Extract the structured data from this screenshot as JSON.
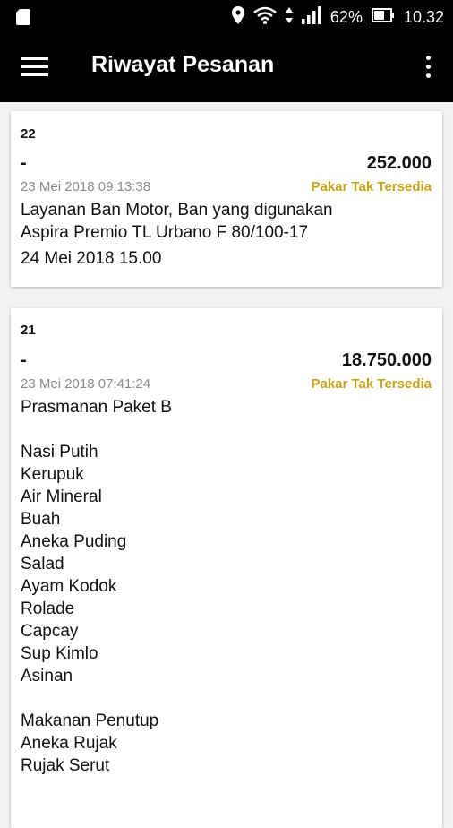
{
  "status_bar": {
    "battery_percent": "62%",
    "time": "10.32"
  },
  "app_bar": {
    "title": "Riwayat Pesanan"
  },
  "orders": [
    {
      "number": "22",
      "dash": "-",
      "price": "252.000",
      "datetime": "23 Mei 2018 09:13:38",
      "status": "Pakar Tak Tersedia",
      "lines": [
        "Layanan Ban Motor, Ban yang digunakan",
        "Aspira Premio TL Urbano F 80/100-17",
        "24 Mei 2018 15.00"
      ]
    },
    {
      "number": "21",
      "dash": "-",
      "price": "18.750.000",
      "datetime": "23 Mei 2018 07:41:24",
      "status": "Pakar Tak Tersedia",
      "description": "Prasmanan Paket B\n\nNasi Putih\nKerupuk\nAir Mineral\nBuah\nAneka Puding\nSalad\nAyam Kodok\nRolade\nCapcay\nSup Kimlo\nAsinan\n\nMakanan Penutup\nAneka Rujak\nRujak Serut"
    }
  ]
}
